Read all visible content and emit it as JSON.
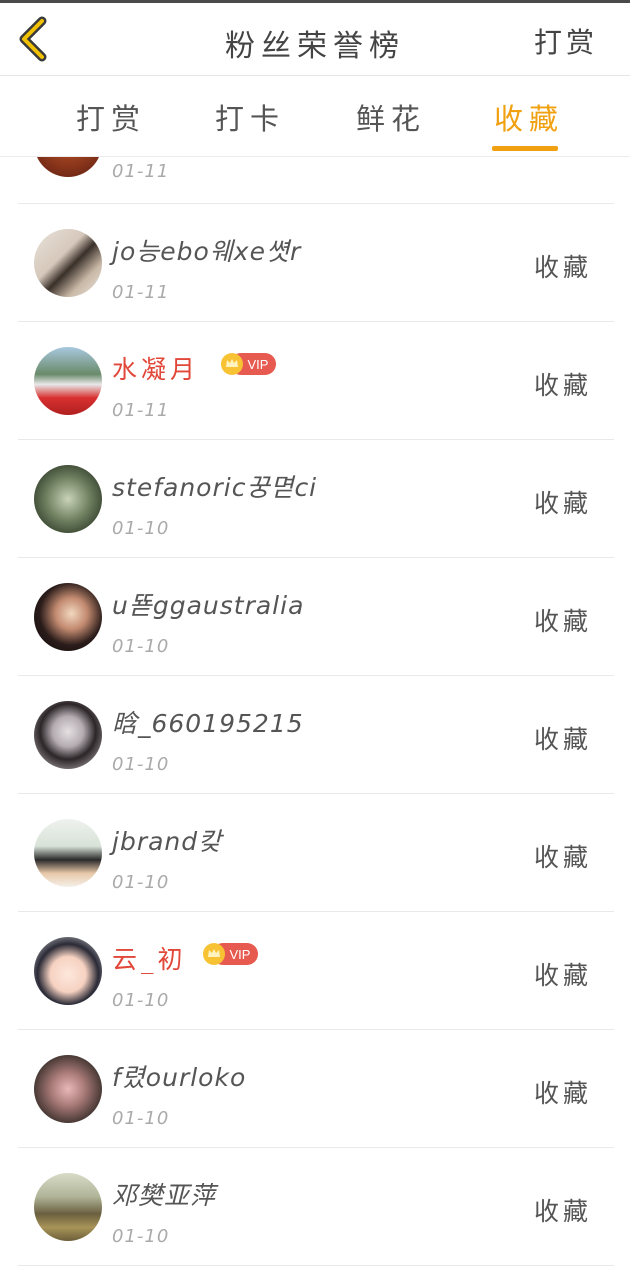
{
  "header": {
    "title": "粉丝荣誉榜",
    "right_action": "打赏"
  },
  "tabs": [
    {
      "label": "打赏",
      "active": false
    },
    {
      "label": "打卡",
      "active": false
    },
    {
      "label": "鲜花",
      "active": false
    },
    {
      "label": "收藏",
      "active": true
    }
  ],
  "colors": {
    "accent": "#f0a010",
    "vip_name": "#e2483a",
    "vip_badge": "#e75a4f"
  },
  "vip_badge_label": "VIP",
  "list": {
    "partial_row": {
      "date": "01-11"
    },
    "items": [
      {
        "name": "jo능ebo웨xe쎳r",
        "date": "01-11",
        "action": "收藏",
        "vip": false
      },
      {
        "name": "水凝月",
        "date": "01-11",
        "action": "收藏",
        "vip": true
      },
      {
        "name": "stefanoric꿍멷ci",
        "date": "01-10",
        "action": "收藏",
        "vip": false
      },
      {
        "name": "u뚇ggaustralia",
        "date": "01-10",
        "action": "收藏",
        "vip": false
      },
      {
        "name": "晗_660195215",
        "date": "01-10",
        "action": "收藏",
        "vip": false
      },
      {
        "name": "jbrand캊",
        "date": "01-10",
        "action": "收藏",
        "vip": false
      },
      {
        "name": "云_初",
        "date": "01-10",
        "action": "收藏",
        "vip": true
      },
      {
        "name": "f렸ourloko",
        "date": "01-10",
        "action": "收藏",
        "vip": false
      },
      {
        "name": "邓樊亚萍",
        "date": "01-10",
        "action": "收藏",
        "vip": false
      }
    ]
  }
}
